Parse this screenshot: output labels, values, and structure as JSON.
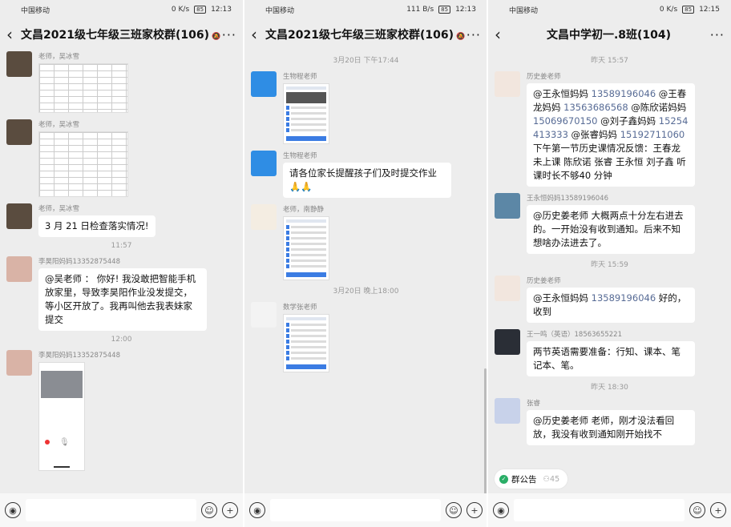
{
  "status_bars": [
    {
      "carrier": "中国移动",
      "speed": "0 K/s",
      "time": "12:13",
      "battery": "85"
    },
    {
      "carrier": "中国移动",
      "speed": "111 B/s",
      "time": "12:13",
      "battery": "85"
    },
    {
      "carrier": "中国移动",
      "speed": "0 K/s",
      "time": "12:15",
      "battery": "85"
    }
  ],
  "panels": [
    {
      "title": "文昌2021级七年级三班家校群(106)"
    },
    {
      "title": "文昌2021级七年级三班家校群(106)"
    },
    {
      "title": "文昌中学初一.8班(104)"
    }
  ],
  "icons": {
    "back": "back-arrow-icon",
    "more": "more-icon",
    "voice": "voice-icon",
    "emoji": "emoji-icon",
    "plus": "plus-icon",
    "mute": "mute-icon"
  },
  "glyphs": {
    "back": "‹",
    "more": "···",
    "voice": "◉",
    "emoji": "☺",
    "plus": "+",
    "mute": "🔕",
    "mic": "🎙",
    "dot": "✓",
    "people": "⚇"
  },
  "p1": {
    "m1_sender": "老师，吴冰雪",
    "m2_sender": "老师，吴冰雪",
    "m3_sender": "老师，吴冰雪",
    "m3_text": "3 月 21 日检查落实情况!",
    "ts1": "11:57",
    "m4_sender": "李昊阳妈妈13352875448",
    "m4_text": "@吴老师 ： 你好! 我没敢把智能手机放家里，导致李昊阳作业没发提交，等小区开放了。我再叫他去我表妹家提交",
    "ts2": "12:00",
    "m5_sender": "李昊阳妈妈13352875448"
  },
  "p2": {
    "ts1": "3月20日 下午17:44",
    "m1_sender": "生物程老师",
    "m2_sender": "生物程老师",
    "m2_text": "请各位家长提醒孩子们及时提交作业🙏🙏",
    "m3_sender": "老师，南静静",
    "ts2": "3月20日 晚上18:00",
    "m4_sender": "数学张老师"
  },
  "p3": {
    "ts1": "昨天 15:57",
    "m1_sender": "历史姜老师",
    "m1_parts": [
      "@王永恒妈妈 ",
      "13589196046",
      " @王春龙妈妈 ",
      "13563686568",
      " @陈欣诺妈妈 ",
      "15069670150",
      " @刘子鑫妈妈 ",
      "15254413333",
      " @张睿妈妈 ",
      "15192711060",
      " 下午第一节历史课情况反馈：王春龙未上课 陈欣诺 张睿 王永恒 刘子鑫 听课时长不够40 分钟"
    ],
    "m2_sender": "王永恒妈妈13589196046",
    "m2_text": "@历史姜老师  大概两点十分左右进去的。一开始没有收到通知。后来不知想啥办法进去了。",
    "ts2": "昨天 15:59",
    "m3_sender": "历史姜老师",
    "m3_parts": [
      "@王永恒妈妈 ",
      "13589196046",
      " 好的，收到"
    ],
    "m4_sender": "王一鸣（英语）18563655221",
    "m4_text": "两节英语需要准备：行知、课本、笔记本、笔。",
    "ts3": "昨天 18:30",
    "m5_sender": "张睿",
    "m5_text": "@历史姜老师  老师，刚才没法看回放，我没有收到通知刚开始找不",
    "notice_label": "群公告",
    "notice_count": "45"
  }
}
